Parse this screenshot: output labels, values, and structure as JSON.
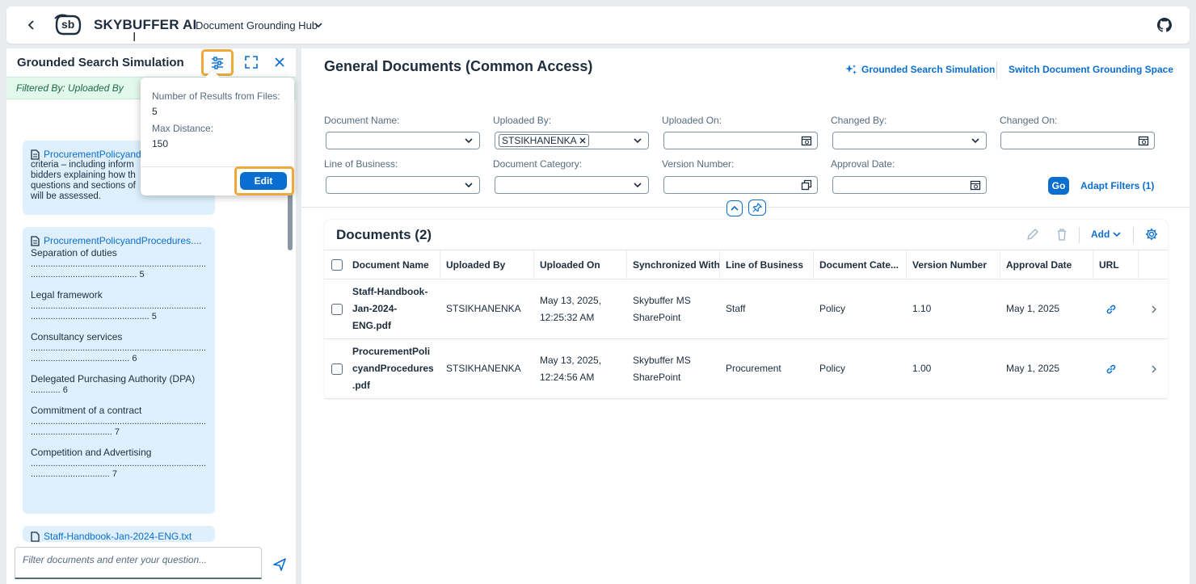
{
  "shell": {
    "brand": "SKYBUFFER AI",
    "logo_text": "sb",
    "space": "Document Grounding Hub"
  },
  "panel": {
    "title": "Grounded Search Simulation",
    "filter_text": "Filtered By: Uploaded By",
    "card1": {
      "doc": "ProcurementPolicyand",
      "snippet": [
        "criteria – including inform",
        "bidders explaining how th",
        "questions and sections of",
        "will be assessed."
      ]
    },
    "card2": {
      "doc": "ProcurementPolicyandProcedures....",
      "first": "Separation of duties",
      "first_page": "5",
      "items": [
        {
          "title": "Legal framework",
          "page": "5"
        },
        {
          "title": "Consultancy services",
          "page": "6"
        },
        {
          "title": "Delegated Purchasing Authority (DPA)",
          "page": "6"
        },
        {
          "title": "Commitment of a contract",
          "page": "7"
        },
        {
          "title": "Competition and Advertising",
          "page": "7"
        }
      ]
    },
    "card3": {
      "doc": "Staff-Handbook-Jan-2024-ENG.txt"
    },
    "chat_placeholder": "Filter documents and enter your question..."
  },
  "popover": {
    "results_label": "Number of Results from Files:",
    "results_value": "5",
    "distance_label": "Max Distance:",
    "distance_value": "150",
    "edit": "Edit"
  },
  "main": {
    "title": "General Documents (Common Access)",
    "gss_link": "Grounded Search Simulation",
    "switch_link": "Switch Document Grounding Space",
    "filters": {
      "doc_name": "Document Name:",
      "uploaded_by": "Uploaded By:",
      "uploaded_by_token": "STSIKHANENKA",
      "uploaded_on": "Uploaded On:",
      "changed_by": "Changed By:",
      "changed_on": "Changed On:",
      "lob": "Line of Business:",
      "doc_category": "Document Category:",
      "version": "Version Number:",
      "approval": "Approval Date:",
      "go": "Go",
      "adapt": "Adapt Filters (1)"
    },
    "table": {
      "title": "Documents (2)",
      "add": "Add",
      "columns": [
        "Document Name",
        "Uploaded By",
        "Uploaded On",
        "Synchronized With",
        "Line of Business",
        "Document Cate...",
        "Version Number",
        "Approval Date",
        "URL"
      ],
      "rows": [
        {
          "name": [
            "Staff-Handbook-",
            "Jan-2024-",
            "ENG.pdf"
          ],
          "uploaded_by": "STSIKHANENKA",
          "uploaded_on": [
            "May 13, 2025,",
            "12:25:32 AM"
          ],
          "sync": [
            "Skybuffer MS",
            "SharePoint"
          ],
          "lob": "Staff",
          "category": "Policy",
          "version": "1.10",
          "approval": "May 1, 2025"
        },
        {
          "name": [
            "ProcurementPoli",
            "cyandProcedures",
            ".pdf"
          ],
          "uploaded_by": "STSIKHANENKA",
          "uploaded_on": [
            "May 13, 2025,",
            "12:24:56 AM"
          ],
          "sync": [
            "Skybuffer MS",
            "SharePoint"
          ],
          "lob": "Procurement",
          "category": "Policy",
          "version": "1.00",
          "approval": "May 1, 2025"
        }
      ]
    }
  }
}
